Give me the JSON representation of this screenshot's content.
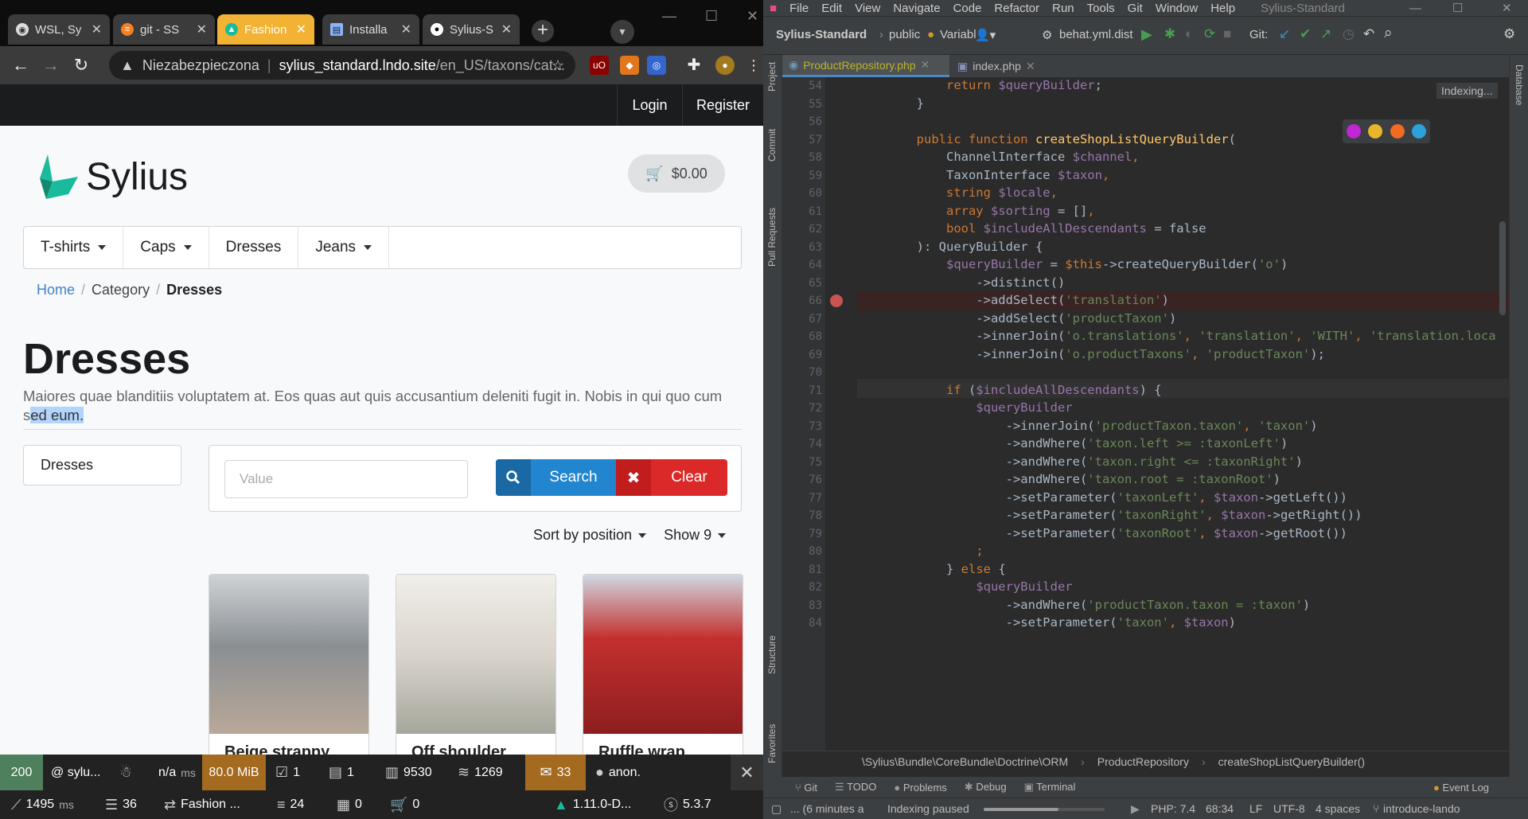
{
  "browser": {
    "tabs": [
      {
        "title": "WSL, Sy",
        "icon": "wsl-icon"
      },
      {
        "title": "git - SS",
        "icon": "stackoverflow-icon"
      },
      {
        "title": "Fashion",
        "icon": "sylius-icon",
        "active": true
      },
      {
        "title": "Installa",
        "icon": "docs-icon"
      },
      {
        "title": "Sylius-S",
        "icon": "github-icon"
      }
    ],
    "address": {
      "warning": "Niezabezpieczona",
      "host": "sylius_standard.lndo.site",
      "path": "/en_US/taxons/cat..."
    }
  },
  "shop": {
    "top_links": {
      "login": "Login",
      "register": "Register"
    },
    "logo_text": "Sylius",
    "cart": "$0.00",
    "menu": [
      {
        "label": "T-shirts",
        "dropdown": true
      },
      {
        "label": "Caps",
        "dropdown": true
      },
      {
        "label": "Dresses",
        "dropdown": false
      },
      {
        "label": "Jeans",
        "dropdown": true
      }
    ],
    "breadcrumb": {
      "home": "Home",
      "category": "Category",
      "current": "Dresses"
    },
    "title": "Dresses",
    "description_a": "Maiores quae blanditiis voluptatem at. Eos quas aut quis accusantium deleniti fugit in. Nobis in qui quo cum s",
    "description_sel": "ed eum.",
    "sidebar_category": "Dresses",
    "filter": {
      "placeholder": "Value",
      "search": "Search",
      "clear": "Clear"
    },
    "sort": "Sort by position",
    "show": "Show 9",
    "products": [
      {
        "name": "Beige strappy",
        "color": "#8a8f94"
      },
      {
        "name": "Off shoulder",
        "color": "#d9d4cc"
      },
      {
        "name": "Ruffle wrap",
        "color": "#c3302e"
      }
    ]
  },
  "debug_toolbar": {
    "status": "200",
    "route": "@ sylu...",
    "time_na": "n/a",
    "time_na_unit": "ms",
    "memory": "80.0 MiB",
    "forms": "1",
    "logs": "1",
    "db": "9530",
    "cache": "1269",
    "translations": "33",
    "user": "anon.",
    "time": "1495",
    "time_unit": "ms",
    "queries": "36",
    "channel": "Fashion ...",
    "events": "24",
    "twig": "0",
    "cart": "0",
    "sylius_version": "1.11.0-D...",
    "symfony_version": "5.3.7"
  },
  "ide": {
    "menu": [
      "File",
      "Edit",
      "View",
      "Navigate",
      "Code",
      "Refactor",
      "Run",
      "Tools",
      "Git",
      "Window",
      "Help"
    ],
    "project_title": "Sylius-Standard",
    "toolbar": {
      "project": "Sylius-Standard",
      "folder": "public",
      "variable": "Variabl",
      "run_config": "behat.yml.dist",
      "git_label": "Git:"
    },
    "tabs": [
      {
        "name": "ProductRepository.php",
        "active": true
      },
      {
        "name": "index.php",
        "active": false
      }
    ],
    "indexing_tip": "Indexing...",
    "side_tools": {
      "project": "Project",
      "commit": "Commit",
      "pull": "Pull Requests",
      "structure": "Structure",
      "favorites": "Favorites",
      "database": "Database"
    },
    "breadcrumb": [
      "\\Sylius\\Bundle\\CoreBundle\\Doctrine\\ORM",
      "ProductRepository",
      "createShopListQueryBuilder()"
    ],
    "tool_windows": [
      "Git",
      "TODO",
      "Problems",
      "Debug",
      "Terminal"
    ],
    "event_log": "Event Log",
    "status": {
      "time": "... (6 minutes a",
      "indexing": "Indexing paused",
      "php": "PHP: 7.4",
      "pos": "68:34",
      "le": "LF",
      "enc": "UTF-8",
      "indent": "4 spaces",
      "branch": "introduce-lando"
    },
    "code": [
      {
        "n": "54",
        "t": [
          [
            "            ",
            ""
          ],
          [
            "return ",
            "kw"
          ],
          [
            "$queryBuilder",
            "vr"
          ],
          [
            ";",
            ""
          ]
        ]
      },
      {
        "n": "55",
        "t": [
          [
            "        }",
            ""
          ]
        ]
      },
      {
        "n": "56",
        "t": []
      },
      {
        "n": "57",
        "t": [
          [
            "        ",
            ""
          ],
          [
            "public function ",
            "kw"
          ],
          [
            "createShopListQueryBuilder",
            "fn"
          ],
          [
            "(",
            ""
          ]
        ]
      },
      {
        "n": "58",
        "t": [
          [
            "            ChannelInterface ",
            ""
          ],
          [
            "$channel",
            "vr"
          ],
          [
            ",",
            "kw"
          ]
        ]
      },
      {
        "n": "59",
        "t": [
          [
            "            TaxonInterface ",
            ""
          ],
          [
            "$taxon",
            "vr"
          ],
          [
            ",",
            "kw"
          ]
        ]
      },
      {
        "n": "60",
        "t": [
          [
            "            string ",
            "kw"
          ],
          [
            "$locale",
            "vr"
          ],
          [
            ",",
            "kw"
          ]
        ]
      },
      {
        "n": "61",
        "t": [
          [
            "            array ",
            "kw"
          ],
          [
            "$sorting",
            "vr"
          ],
          [
            " = []",
            ""
          ],
          [
            ",",
            "kw"
          ]
        ]
      },
      {
        "n": "62",
        "t": [
          [
            "            bool ",
            "kw"
          ],
          [
            "$includeAllDescendants",
            "vr"
          ],
          [
            " = false",
            ""
          ]
        ]
      },
      {
        "n": "63",
        "t": [
          [
            "        ): QueryBuilder {",
            ""
          ]
        ]
      },
      {
        "n": "64",
        "t": [
          [
            "            ",
            ""
          ],
          [
            "$queryBuilder",
            "vr"
          ],
          [
            " = ",
            ""
          ],
          [
            "$this",
            "kw"
          ],
          [
            "->createQueryBuilder(",
            ""
          ],
          [
            "'o'",
            "st"
          ],
          [
            ")",
            ""
          ]
        ]
      },
      {
        "n": "65",
        "t": [
          [
            "                ->distinct()",
            ""
          ]
        ]
      },
      {
        "n": "66",
        "t": [
          [
            "                ->addSelect(",
            ""
          ],
          [
            "'translation'",
            "st"
          ],
          [
            ")",
            ""
          ]
        ]
      },
      {
        "n": "67",
        "t": [
          [
            "                ->addSelect(",
            ""
          ],
          [
            "'productTaxon'",
            "st"
          ],
          [
            ")",
            ""
          ]
        ]
      },
      {
        "n": "68",
        "t": [
          [
            "                ->innerJoin(",
            ""
          ],
          [
            "'o.translations'",
            "st"
          ],
          [
            ", ",
            "kw"
          ],
          [
            "'translation'",
            "st"
          ],
          [
            ", ",
            "kw"
          ],
          [
            "'WITH'",
            "st"
          ],
          [
            ", ",
            "kw"
          ],
          [
            "'translation.loca",
            "st"
          ]
        ]
      },
      {
        "n": "69",
        "t": [
          [
            "                ->innerJoin(",
            ""
          ],
          [
            "'o.productTaxons'",
            "st"
          ],
          [
            ", ",
            "kw"
          ],
          [
            "'productTaxon'",
            "st"
          ],
          [
            ");",
            ""
          ]
        ]
      },
      {
        "n": "70",
        "t": []
      },
      {
        "n": "71",
        "t": [
          [
            "            ",
            ""
          ],
          [
            "if ",
            "kw"
          ],
          [
            "(",
            ""
          ],
          [
            "$includeAllDescendants",
            "vr"
          ],
          [
            ") {",
            ""
          ]
        ]
      },
      {
        "n": "72",
        "t": [
          [
            "                ",
            ""
          ],
          [
            "$queryBuilder",
            "vr"
          ]
        ]
      },
      {
        "n": "73",
        "t": [
          [
            "                    ->innerJoin(",
            ""
          ],
          [
            "'productTaxon.taxon'",
            "st"
          ],
          [
            ", ",
            "kw"
          ],
          [
            "'taxon'",
            "st"
          ],
          [
            ")",
            ""
          ]
        ]
      },
      {
        "n": "74",
        "t": [
          [
            "                    ->andWhere(",
            ""
          ],
          [
            "'taxon.left >= :taxonLeft'",
            "st"
          ],
          [
            ")",
            ""
          ]
        ]
      },
      {
        "n": "75",
        "t": [
          [
            "                    ->andWhere(",
            ""
          ],
          [
            "'taxon.right <= :taxonRight'",
            "st"
          ],
          [
            ")",
            ""
          ]
        ]
      },
      {
        "n": "76",
        "t": [
          [
            "                    ->andWhere(",
            ""
          ],
          [
            "'taxon.root = :taxonRoot'",
            "st"
          ],
          [
            ")",
            ""
          ]
        ]
      },
      {
        "n": "77",
        "t": [
          [
            "                    ->setParameter(",
            ""
          ],
          [
            "'taxonLeft'",
            "st"
          ],
          [
            ", ",
            "kw"
          ],
          [
            "$taxon",
            "vr"
          ],
          [
            "->getLeft())",
            ""
          ]
        ]
      },
      {
        "n": "78",
        "t": [
          [
            "                    ->setParameter(",
            ""
          ],
          [
            "'taxonRight'",
            "st"
          ],
          [
            ", ",
            "kw"
          ],
          [
            "$taxon",
            "vr"
          ],
          [
            "->getRight())",
            ""
          ]
        ]
      },
      {
        "n": "79",
        "t": [
          [
            "                    ->setParameter(",
            ""
          ],
          [
            "'taxonRoot'",
            "st"
          ],
          [
            ", ",
            "kw"
          ],
          [
            "$taxon",
            "vr"
          ],
          [
            "->getRoot())",
            ""
          ]
        ]
      },
      {
        "n": "80",
        "t": [
          [
            "                ",
            ""
          ],
          [
            ";",
            "kw"
          ]
        ]
      },
      {
        "n": "81",
        "t": [
          [
            "            } ",
            ""
          ],
          [
            "else ",
            "kw"
          ],
          [
            "{",
            ""
          ]
        ]
      },
      {
        "n": "82",
        "t": [
          [
            "                ",
            ""
          ],
          [
            "$queryBuilder",
            "vr"
          ]
        ]
      },
      {
        "n": "83",
        "t": [
          [
            "                    ->andWhere(",
            ""
          ],
          [
            "'productTaxon.taxon = :taxon'",
            "st"
          ],
          [
            ")",
            ""
          ]
        ]
      },
      {
        "n": "84",
        "t": [
          [
            "                    ->setParameter(",
            ""
          ],
          [
            "'taxon'",
            "st"
          ],
          [
            ", ",
            "kw"
          ],
          [
            "$taxon",
            "vr"
          ],
          [
            ")",
            ""
          ]
        ]
      }
    ]
  }
}
